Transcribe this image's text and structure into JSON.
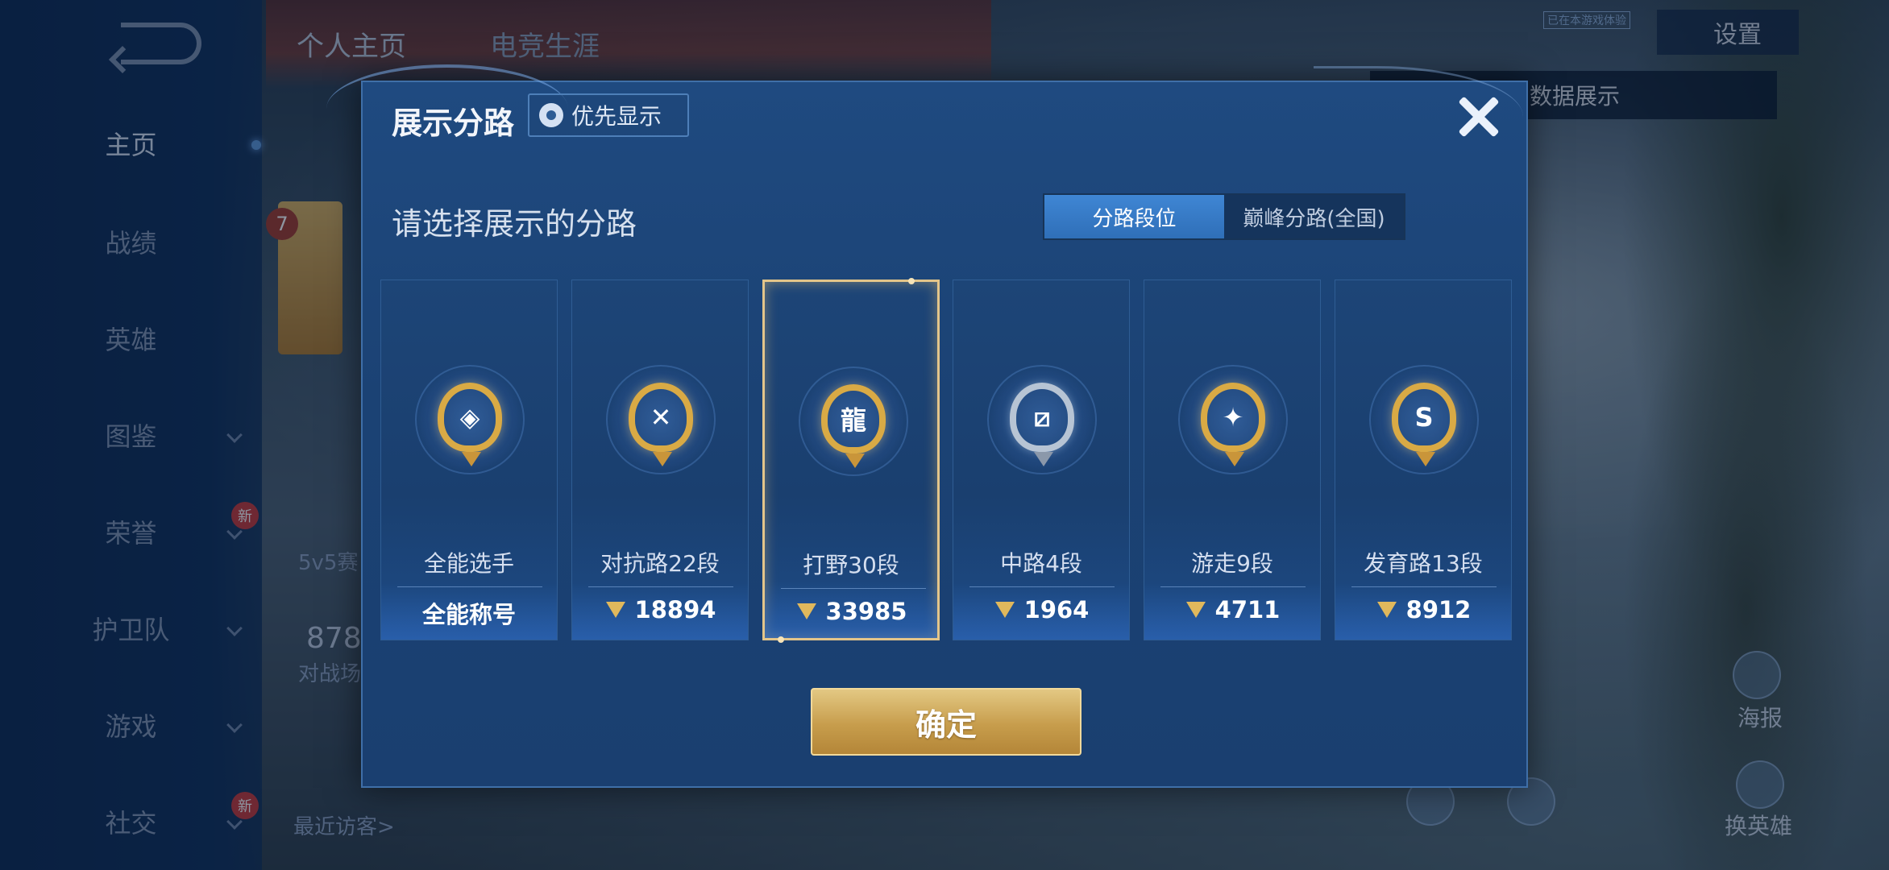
{
  "header": {
    "tabs": [
      "个人主页",
      "电竞生涯"
    ],
    "settings_label": "设置",
    "hint": "点切换灵宝和数据展示",
    "tag": "已在本游戏体验"
  },
  "sidebar": {
    "items": [
      {
        "label": "主页",
        "active": true,
        "chevron": false,
        "new": false
      },
      {
        "label": "战绩",
        "active": false,
        "chevron": false,
        "new": false
      },
      {
        "label": "英雄",
        "active": false,
        "chevron": false,
        "new": false
      },
      {
        "label": "图鉴",
        "active": false,
        "chevron": true,
        "new": false
      },
      {
        "label": "荣誉",
        "active": false,
        "chevron": true,
        "new": true
      },
      {
        "label": "护卫队",
        "active": false,
        "chevron": true,
        "new": false
      },
      {
        "label": "游戏",
        "active": false,
        "chevron": true,
        "new": false
      },
      {
        "label": "社交",
        "active": false,
        "chevron": true,
        "new": true
      }
    ],
    "new_label": "新"
  },
  "behind": {
    "level": "7",
    "mode": "5v5赛",
    "count": "878",
    "count_label": "对战场",
    "visitors": "最近访客>"
  },
  "right_buttons": {
    "poster": "海报",
    "switch_hero": "换英雄",
    "new_label": "新"
  },
  "modal": {
    "title": "展示分路",
    "priority_label": "优先显示",
    "prompt": "请选择展示的分路",
    "toggle": [
      "分路段位",
      "巅峰分路(全国)"
    ],
    "toggle_selected": 0,
    "confirm_label": "确定",
    "cards": [
      {
        "title": "全能选手",
        "value": "全能称号",
        "points_icon": false,
        "icon": "all-round-badge-icon",
        "symbol": "◈",
        "selected": false,
        "silver": false
      },
      {
        "title": "对抗路22段",
        "value": "18894",
        "points_icon": true,
        "icon": "clash-lane-badge-icon",
        "symbol": "✕",
        "selected": false,
        "silver": false
      },
      {
        "title": "打野30段",
        "value": "33985",
        "points_icon": true,
        "icon": "jungle-dragon-badge-icon",
        "symbol": "龍",
        "selected": true,
        "silver": false
      },
      {
        "title": "中路4段",
        "value": "1964",
        "points_icon": true,
        "icon": "mid-lane-badge-icon",
        "symbol": "⧄",
        "selected": false,
        "silver": true
      },
      {
        "title": "游走9段",
        "value": "4711",
        "points_icon": true,
        "icon": "roam-wings-badge-icon",
        "symbol": "✦",
        "selected": false,
        "silver": false
      },
      {
        "title": "发育路13段",
        "value": "8912",
        "points_icon": true,
        "icon": "farm-lane-badge-icon",
        "symbol": "S",
        "selected": false,
        "silver": false
      }
    ]
  },
  "colors": {
    "badge_gold": "#d9aa45",
    "selection_border": "#e3c58a",
    "toggle_active": "#3f86d4",
    "confirm_gold": "#c79d4c"
  }
}
